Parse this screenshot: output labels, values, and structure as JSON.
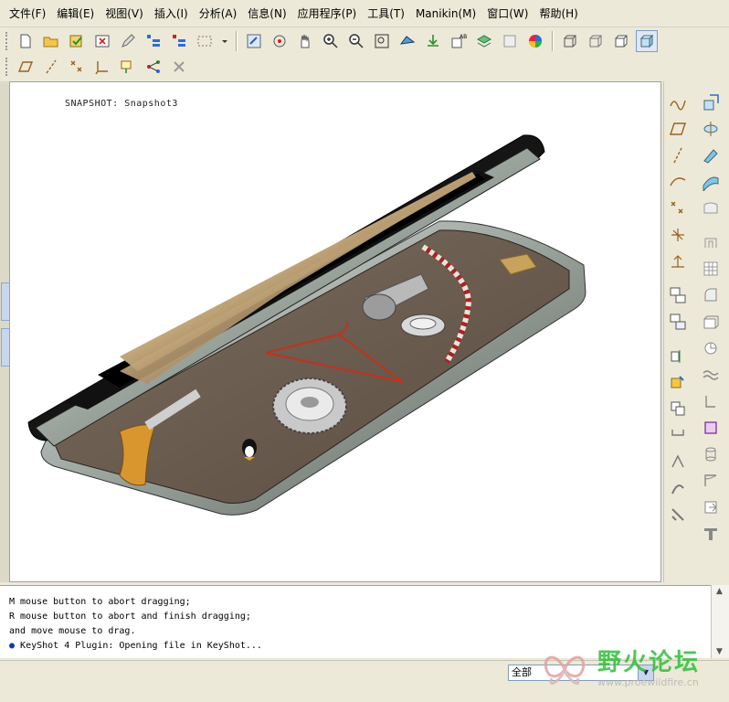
{
  "menu": [
    {
      "label": "文件(F)"
    },
    {
      "label": "编辑(E)"
    },
    {
      "label": "视图(V)"
    },
    {
      "label": "插入(I)"
    },
    {
      "label": "分析(A)"
    },
    {
      "label": "信息(N)"
    },
    {
      "label": "应用程序(P)"
    },
    {
      "label": "工具(T)"
    },
    {
      "label": "Manikin(M)"
    },
    {
      "label": "窗口(W)"
    },
    {
      "label": "帮助(H)"
    }
  ],
  "viewport": {
    "snapshot_label": "SNAPSHOT: Snapshot3"
  },
  "messages": [
    "M mouse button to abort dragging;",
    "R mouse button to abort and finish dragging;",
    "and move mouse to drag."
  ],
  "last_message": "KeyShot 4 Plugin: Opening file in KeyShot...",
  "status": {
    "filter_value": "全部"
  },
  "watermark": {
    "text": "野火论坛",
    "url": "www.proewildfire.cn"
  },
  "colors": {
    "accent": "#2fbf3a",
    "viewport_bg": "#ffffff",
    "chrome_bg": "#ece9d8"
  }
}
